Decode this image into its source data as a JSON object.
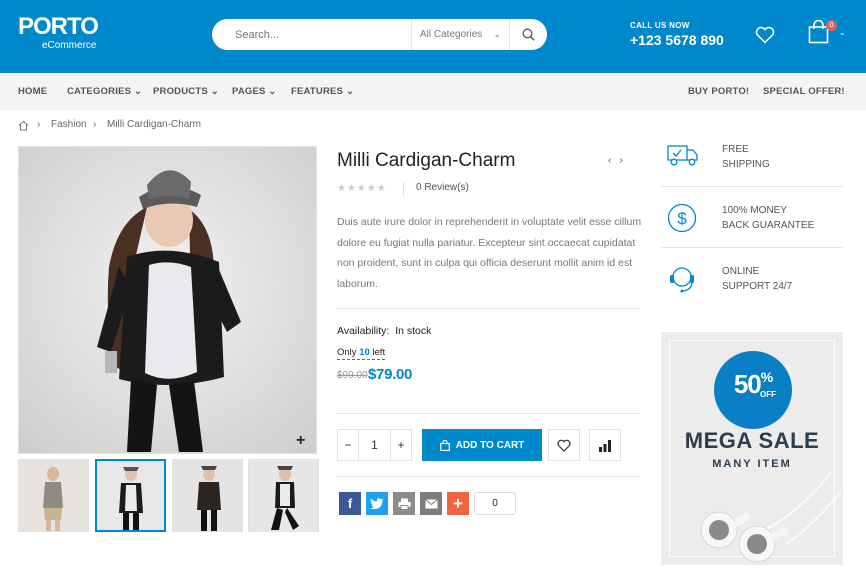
{
  "header": {
    "logo_text": "PORTO",
    "logo_sub": "eCommerce",
    "search_placeholder": "Search...",
    "category_select": "All Categories",
    "call_label": "CALL US NOW",
    "phone": "+123 5678 890",
    "cart_count": "0",
    "bg_color": "#0088cc"
  },
  "nav": {
    "items": [
      "HOME",
      "CATEGORIES",
      "PRODUCTS",
      "PAGES",
      "FEATURES"
    ],
    "right": [
      "BUY PORTO!",
      "SPECIAL OFFER!"
    ]
  },
  "breadcrumb": [
    "Fashion",
    "Milli Cardigan-Charm"
  ],
  "product": {
    "title": "Milli Cardigan-Charm",
    "reviews": "0 Review(s)",
    "rating": 0,
    "description": "Duis aute irure dolor in reprehenderit in voluptate velit esse cillum dolore eu fugiat nulla pariatur. Excepteur sint occaecat cupidatat non proident, sunt in culpa qui officia deserunt mollit anim id est laborum.",
    "availability_label": "Availability:",
    "availability_value": "In stock",
    "only_prefix": "Only",
    "only_count": "10",
    "only_suffix": "left",
    "old_price": "$99.00",
    "price": "$79.00",
    "quantity": "1",
    "add_to_cart": "ADD TO CART",
    "share_count": "0"
  },
  "features": [
    {
      "icon": "truck-icon",
      "line1": "FREE",
      "line2": "SHIPPING"
    },
    {
      "icon": "dollar-icon",
      "line1": "100% MONEY",
      "line2": "BACK GUARANTEE"
    },
    {
      "icon": "headset-icon",
      "line1": "ONLINE",
      "line2": "SUPPORT 24/7"
    }
  ],
  "promo": {
    "percent": "50",
    "percent_sign": "%",
    "off": "OFF",
    "title": "MEGA SALE",
    "subtitle": "MANY ITEM"
  }
}
